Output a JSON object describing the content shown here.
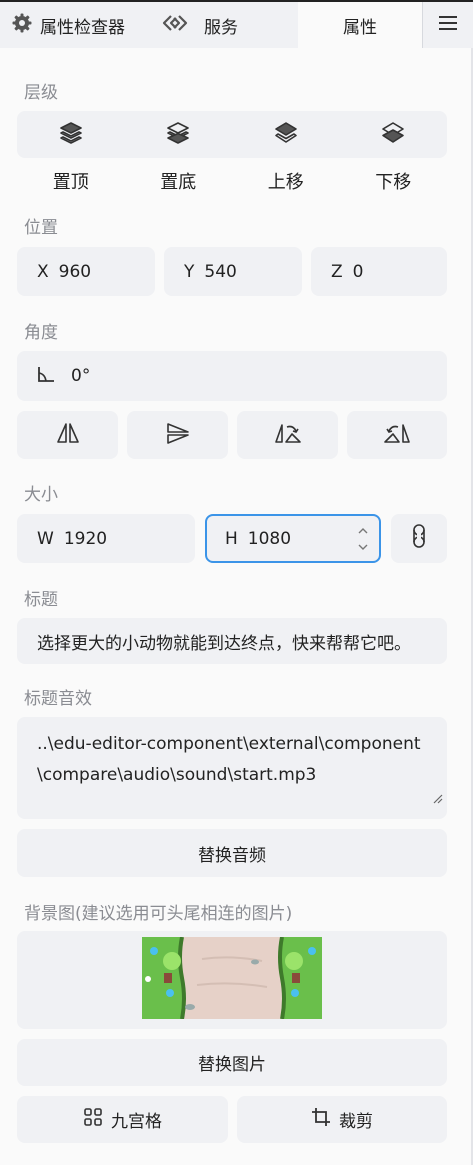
{
  "tabs": {
    "inspector": "属性检查器",
    "service": "服务",
    "properties": "属性",
    "menu_icon": "hamburger-menu-icon"
  },
  "layer": {
    "label": "层级",
    "buttons": [
      "置顶",
      "置底",
      "上移",
      "下移"
    ]
  },
  "position": {
    "label": "位置",
    "x_label": "X",
    "x_value": "960",
    "y_label": "Y",
    "y_value": "540",
    "z_label": "Z",
    "z_value": "0"
  },
  "angle": {
    "label": "角度",
    "value": "0°"
  },
  "size": {
    "label": "大小",
    "w_label": "W",
    "w_value": "1920",
    "h_label": "H",
    "h_value": "1080"
  },
  "title": {
    "label": "标题",
    "value": "选择更大的小动物就能到达终点，快来帮帮它吧。"
  },
  "title_sound": {
    "label": "标题音效",
    "value": "..\\edu-editor-component\\external\\component\\compare\\audio\\sound\\start.mp3",
    "replace_button": "替换音频"
  },
  "background": {
    "label": "背景图(建议选用可头尾相连的图片)",
    "replace_button": "替换图片",
    "nine_grid_button": "九宫格",
    "crop_button": "裁剪"
  },
  "colors": {
    "accent": "#3b94e8",
    "panel": "#f0f1f4",
    "label": "#8a8c92"
  }
}
